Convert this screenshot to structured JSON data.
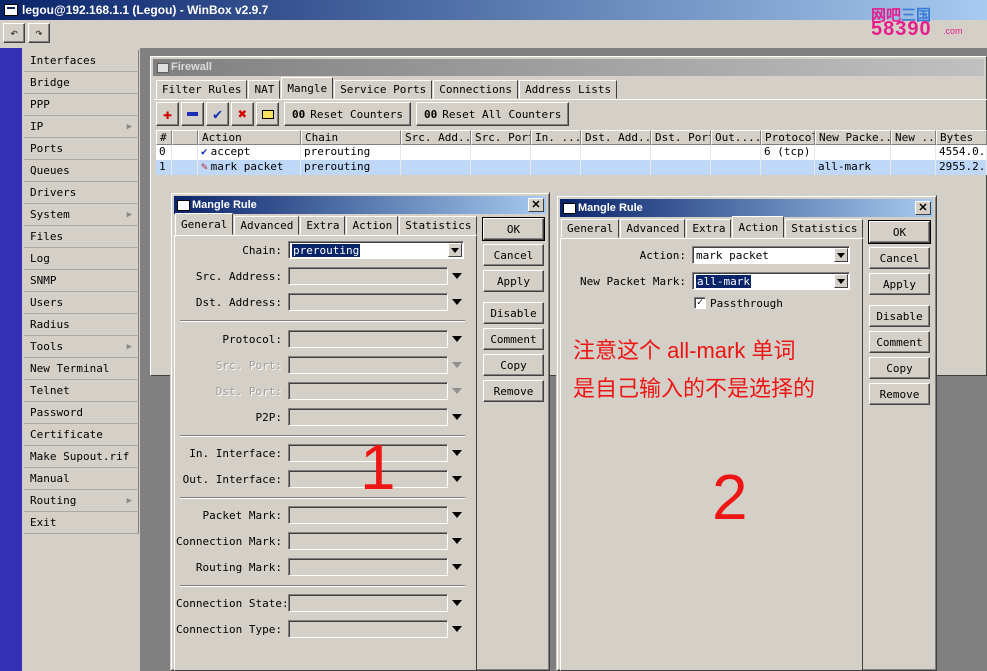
{
  "window": {
    "title": "legou@192.168.1.1 (Legou) - WinBox v2.9.7"
  },
  "logo": {
    "line1": "网吧",
    "line1b": "三国",
    "line2": "58390",
    "domain": ".com"
  },
  "top_toolbar": {
    "undo_icon": "undo-icon",
    "redo_icon": "redo-icon"
  },
  "sidebar": {
    "items": [
      {
        "label": "Interfaces",
        "submenu": false
      },
      {
        "label": "Bridge",
        "submenu": false
      },
      {
        "label": "PPP",
        "submenu": false
      },
      {
        "label": "IP",
        "submenu": true
      },
      {
        "label": "Ports",
        "submenu": false
      },
      {
        "label": "Queues",
        "submenu": false
      },
      {
        "label": "Drivers",
        "submenu": false
      },
      {
        "label": "System",
        "submenu": true
      },
      {
        "label": "Files",
        "submenu": false
      },
      {
        "label": "Log",
        "submenu": false
      },
      {
        "label": "SNMP",
        "submenu": false
      },
      {
        "label": "Users",
        "submenu": false
      },
      {
        "label": "Radius",
        "submenu": false
      },
      {
        "label": "Tools",
        "submenu": true
      },
      {
        "label": "New Terminal",
        "submenu": false
      },
      {
        "label": "Telnet",
        "submenu": false
      },
      {
        "label": "Password",
        "submenu": false
      },
      {
        "label": "Certificate",
        "submenu": false
      },
      {
        "label": "Make Supout.rif",
        "submenu": false
      },
      {
        "label": "Manual",
        "submenu": false
      },
      {
        "label": "Routing",
        "submenu": true
      },
      {
        "label": "Exit",
        "submenu": false
      }
    ]
  },
  "firewall": {
    "title": "Firewall",
    "tabs": [
      "Filter Rules",
      "NAT",
      "Mangle",
      "Service Ports",
      "Connections",
      "Address Lists"
    ],
    "active_tab": "Mangle",
    "toolbar": {
      "reset_counters": "Reset Counters",
      "reset_all_counters": "Reset All Counters",
      "counter_icon_text": "00"
    },
    "columns": [
      "#",
      "Action",
      "Chain",
      "Src. Add...",
      "Src. Port",
      "In. ...",
      "Dst. Add...",
      "Dst. Port",
      "Out....",
      "Protocol",
      "New Packe...",
      "New ...",
      "Bytes"
    ],
    "rows": [
      {
        "num": "0",
        "action": "accept",
        "chain": "prerouting",
        "protocol": "6 (tcp)",
        "new_packet_mark": "",
        "bytes": "4554.0..."
      },
      {
        "num": "1",
        "action": "mark packet",
        "chain": "prerouting",
        "protocol": "",
        "new_packet_mark": "all-mark",
        "bytes": "2955.2..."
      }
    ]
  },
  "dialog1": {
    "title": "Mangle Rule",
    "tabs": [
      "General",
      "Advanced",
      "Extra",
      "Action",
      "Statistics"
    ],
    "active_tab": "General",
    "fields": {
      "chain": {
        "label": "Chain:",
        "value": "prerouting"
      },
      "src_address": {
        "label": "Src. Address:"
      },
      "dst_address": {
        "label": "Dst. Address:"
      },
      "protocol": {
        "label": "Protocol:"
      },
      "src_port": {
        "label": "Src. Port:"
      },
      "dst_port": {
        "label": "Dst. Port:"
      },
      "p2p": {
        "label": "P2P:"
      },
      "in_interface": {
        "label": "In. Interface:"
      },
      "out_interface": {
        "label": "Out. Interface:"
      },
      "packet_mark": {
        "label": "Packet Mark:"
      },
      "connection_mark": {
        "label": "Connection Mark:"
      },
      "routing_mark": {
        "label": "Routing Mark:"
      },
      "connection_state": {
        "label": "Connection State:"
      },
      "connection_type": {
        "label": "Connection Type:"
      }
    },
    "buttons": [
      "OK",
      "Cancel",
      "Apply",
      "Disable",
      "Comment",
      "Copy",
      "Remove"
    ],
    "annotation_number": "1"
  },
  "dialog2": {
    "title": "Mangle Rule",
    "tabs": [
      "General",
      "Advanced",
      "Extra",
      "Action",
      "Statistics"
    ],
    "active_tab": "Action",
    "fields": {
      "action": {
        "label": "Action:",
        "value": "mark packet"
      },
      "new_packet_mark": {
        "label": "New Packet Mark:",
        "value": "all-mark"
      },
      "passthrough": {
        "label": "Passthrough",
        "checked": true
      }
    },
    "buttons": [
      "OK",
      "Cancel",
      "Apply",
      "Disable",
      "Comment",
      "Copy",
      "Remove"
    ],
    "annotation_line1": "注意这个 all-mark 单词",
    "annotation_line2": "是自己输入的不是选择的",
    "annotation_number": "2"
  },
  "colors": {
    "title_bar": "#0a246a",
    "left_strip": "#3431b6",
    "annotation": "#ee1515",
    "logo": "#e61e8c"
  }
}
